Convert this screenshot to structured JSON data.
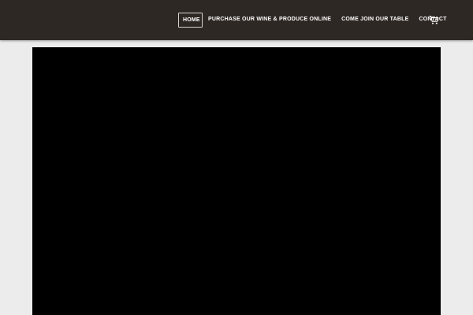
{
  "nav": {
    "items": [
      {
        "label": "HOME",
        "active": true
      },
      {
        "label": "PURCHASE OUR WINE & PRODUCE ONLINE",
        "active": false
      },
      {
        "label": "COME JOIN OUR TABLE",
        "active": false
      },
      {
        "label": "CONTACT",
        "active": false
      }
    ],
    "cart_icon": "shopping-cart-icon"
  },
  "colors": {
    "header_bg": "#2e2824",
    "page_bg": "#ececec",
    "video_bg": "#000000",
    "nav_text": "#ffffff"
  }
}
